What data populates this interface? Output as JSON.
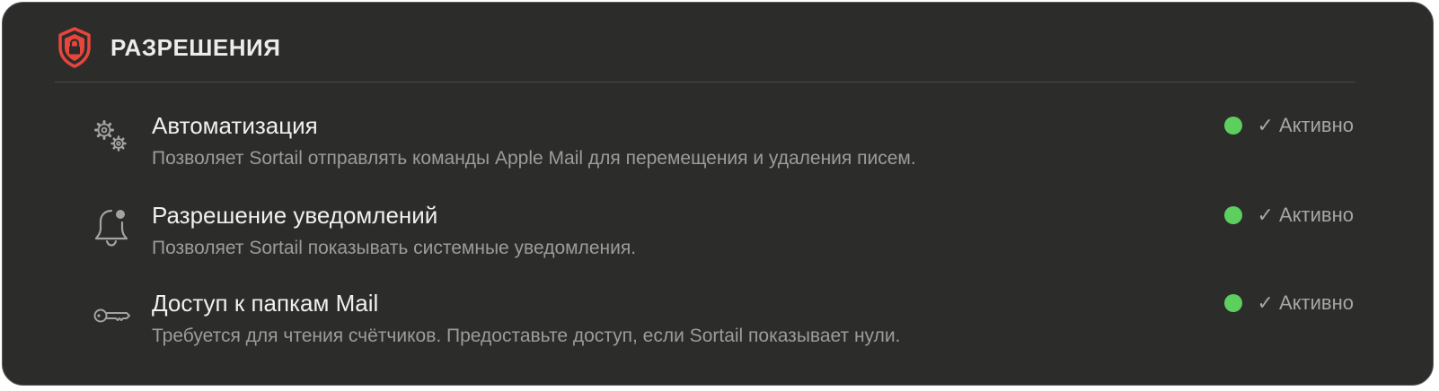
{
  "header": {
    "title": "РАЗРЕШЕНИЯ",
    "icon": "shield-lock-icon",
    "accent": "#e8453c"
  },
  "status_color": "#5ccf5e",
  "permissions": [
    {
      "icon": "gears-icon",
      "title": "Автоматизация",
      "description": "Позволяет Sortail отправлять команды Apple Mail для перемещения и удаления писем.",
      "status": "✓ Активно"
    },
    {
      "icon": "bell-badge-icon",
      "title": "Разрешение уведомлений",
      "description": "Позволяет Sortail показывать системные уведомления.",
      "status": "✓ Активно"
    },
    {
      "icon": "key-icon",
      "title": "Доступ к папкам Mail",
      "description": "Требуется для чтения счётчиков. Предоставьте доступ, если Sortail показывает нули.",
      "status": "✓ Активно"
    }
  ]
}
